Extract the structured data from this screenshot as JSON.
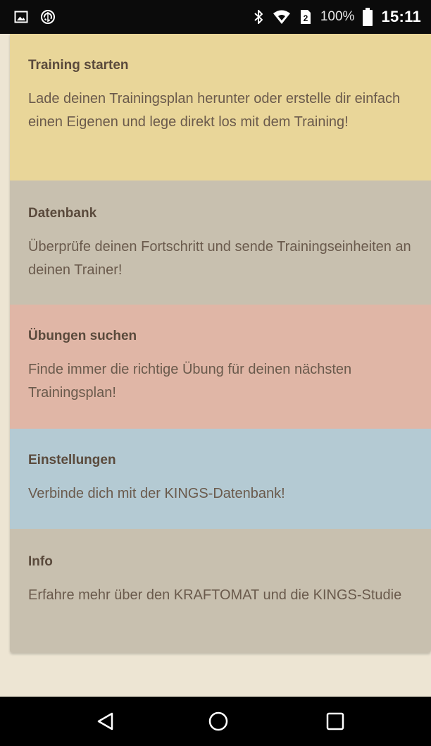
{
  "status_bar": {
    "left_icons": [
      "image-icon",
      "sync-icon"
    ],
    "right_icons": [
      "bluetooth-icon",
      "wifi-icon",
      "sim-icon",
      "battery-icon"
    ],
    "battery_percent_label": "100%",
    "time": "15:11"
  },
  "menu": {
    "items": [
      {
        "title": "Training starten",
        "description": "Lade deinen Trainingsplan herunter oder erstelle dir einfach einen Eigenen und lege direkt los mit dem Training!",
        "color": "#e9d699"
      },
      {
        "title": "Datenbank",
        "description": "Überprüfe deinen Fortschritt und sende Trainingseinheiten an deinen Trainer!",
        "color": "#c8c0af"
      },
      {
        "title": "Übungen suchen",
        "description": "Finde immer die richtige Übung für deinen nächsten Trainingsplan!",
        "color": "#e0b6a6"
      },
      {
        "title": "Einstellungen",
        "description": "Verbinde dich mit der KINGS-Datenbank!",
        "color": "#b4cad3"
      },
      {
        "title": "Info",
        "description": "Erfahre mehr über den KRAFTOMAT und die KINGS-Studie",
        "color": "#c8c0af"
      }
    ]
  },
  "nav_bar": {
    "icons": [
      "back-icon",
      "home-icon",
      "recents-icon"
    ]
  }
}
